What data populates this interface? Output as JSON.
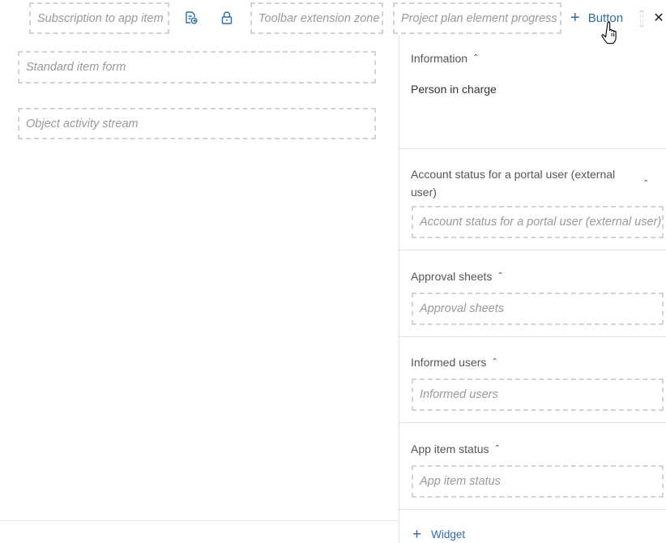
{
  "toolbar": {
    "subscription_zone": "Subscription to app item",
    "toolbar_extension_zone": "Toolbar extension zone",
    "project_plan_zone": "Project plan element progress",
    "add_button_label": "Button",
    "document_icon": "document-export-icon",
    "lock_icon": "lock-icon",
    "close_icon": "close-icon"
  },
  "left": {
    "standard_form_zone": "Standard item form",
    "activity_stream_zone": "Object activity stream"
  },
  "right_panel": {
    "information": {
      "title": "Information",
      "person_in_charge": "Person in charge"
    },
    "account_status": {
      "title": "Account status for a portal user (external user)",
      "zone": "Account status for a portal user (external user)"
    },
    "approval_sheets": {
      "title": "Approval sheets",
      "zone": "Approval sheets"
    },
    "informed_users": {
      "title": "Informed users",
      "zone": "Informed users"
    },
    "app_item_status": {
      "title": "App item status",
      "zone": "App item status"
    },
    "add_widget_label": "Widget"
  },
  "colors": {
    "accent": "#2f6ba8",
    "dashed_border": "#d3d3d3",
    "placeholder_text": "#999999",
    "divider": "#e3e3e3"
  }
}
